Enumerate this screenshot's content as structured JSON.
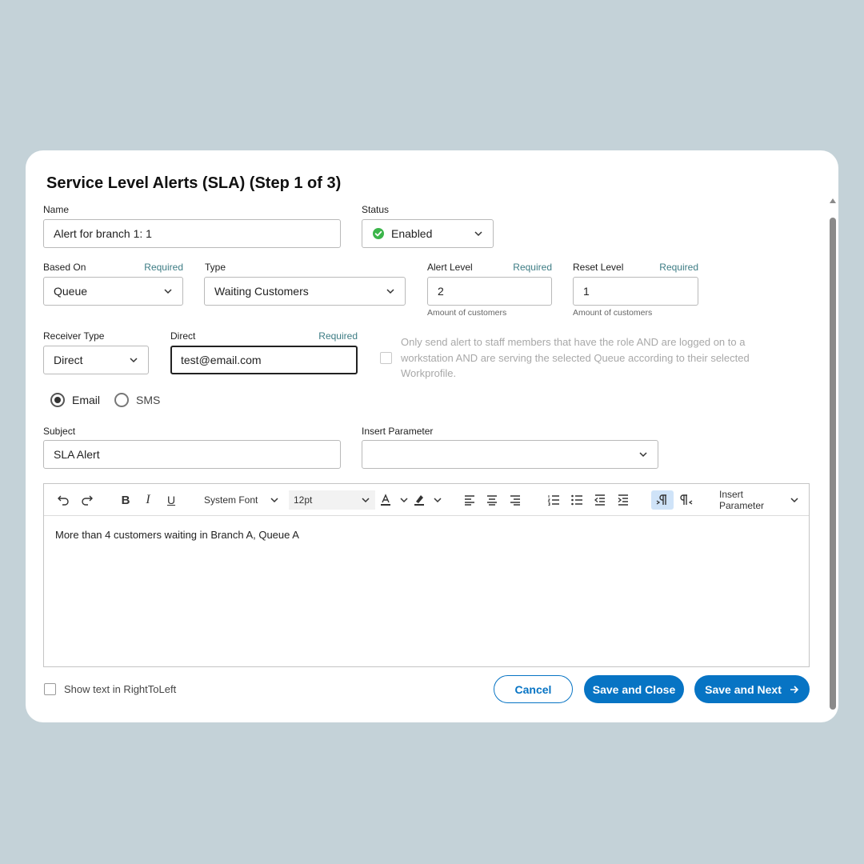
{
  "dialog": {
    "title": "Service Level Alerts (SLA) (Step 1 of 3)"
  },
  "required_label": "Required",
  "name": {
    "label": "Name",
    "value": "Alert for branch 1: 1"
  },
  "status": {
    "label": "Status",
    "value": "Enabled",
    "icon": "check-circle-icon",
    "color": "#3bb54a"
  },
  "based_on": {
    "label": "Based On",
    "value": "Queue"
  },
  "type": {
    "label": "Type",
    "value": "Waiting Customers"
  },
  "alert_level": {
    "label": "Alert Level",
    "value": "2",
    "hint": "Amount of customers"
  },
  "reset_level": {
    "label": "Reset Level",
    "value": "1",
    "hint": "Amount of customers"
  },
  "receiver_type": {
    "label": "Receiver Type",
    "value": "Direct"
  },
  "direct": {
    "label": "Direct",
    "value": "test@email.com"
  },
  "only_send": {
    "text": "Only send alert to staff members that have the role AND are logged on to a workstation AND are serving the selected Queue according to their selected Workprofile.",
    "checked": false,
    "disabled": true
  },
  "channel": {
    "options": [
      {
        "label": "Email",
        "selected": true
      },
      {
        "label": "SMS",
        "selected": false
      }
    ]
  },
  "subject": {
    "label": "Subject",
    "value": "SLA Alert"
  },
  "insert_parameter": {
    "label": "Insert Parameter",
    "value": ""
  },
  "editor": {
    "toolbar": {
      "font": "System Font",
      "size": "12pt",
      "insert_parameter": "Insert Parameter"
    },
    "content": "More than 4 customers waiting in Branch A, Queue A"
  },
  "rtl": {
    "label": "Show text in RightToLeft",
    "checked": false
  },
  "buttons": {
    "cancel": "Cancel",
    "save_close": "Save and Close",
    "save_next": "Save and Next"
  },
  "colors": {
    "accent": "#0774c4",
    "required": "#3d7c84",
    "background": "#c4d2d8"
  }
}
